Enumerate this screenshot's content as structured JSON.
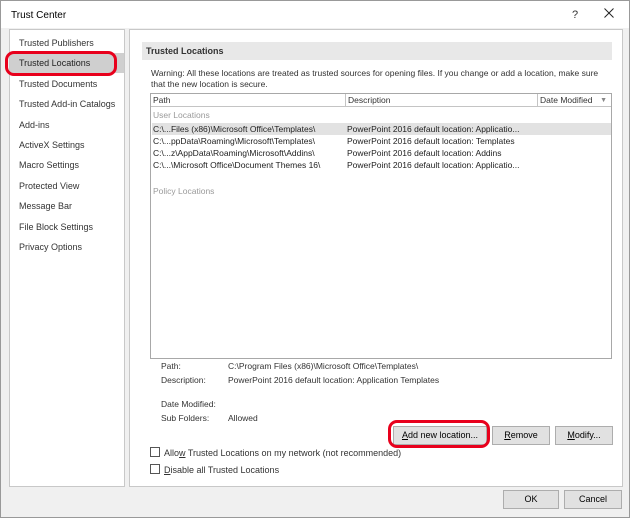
{
  "window": {
    "title": "Trust Center",
    "help_label": "?"
  },
  "sidebar": {
    "items": [
      {
        "label": "Trusted Publishers"
      },
      {
        "label": "Trusted Locations"
      },
      {
        "label": "Trusted Documents"
      },
      {
        "label": "Trusted Add-in Catalogs"
      },
      {
        "label": "Add-ins"
      },
      {
        "label": "ActiveX Settings"
      },
      {
        "label": "Macro Settings"
      },
      {
        "label": "Protected View"
      },
      {
        "label": "Message Bar"
      },
      {
        "label": "File Block Settings"
      },
      {
        "label": "Privacy Options"
      }
    ],
    "selected_index": 1
  },
  "main": {
    "section_title": "Trusted Locations",
    "warning": "Warning: All these locations are treated as trusted sources for opening files.  If you change or add a location, make sure that the new location is secure.",
    "columns": {
      "path": "Path",
      "description": "Description",
      "date_modified": "Date Modified"
    },
    "user_group_label": "User Locations",
    "policy_group_label": "Policy Locations",
    "rows": [
      {
        "path": "C:\\...Files (x86)\\Microsoft Office\\Templates\\",
        "description": "PowerPoint 2016 default location: Applicatio..."
      },
      {
        "path": "C:\\...ppData\\Roaming\\Microsoft\\Templates\\",
        "description": "PowerPoint 2016 default location: Templates"
      },
      {
        "path": "C:\\...z\\AppData\\Roaming\\Microsoft\\Addins\\",
        "description": "PowerPoint 2016 default location: Addins"
      },
      {
        "path": "C:\\...\\Microsoft Office\\Document Themes 16\\",
        "description": "PowerPoint 2016 default location: Applicatio..."
      }
    ],
    "details": {
      "path_label": "Path:",
      "path_value": "C:\\Program Files (x86)\\Microsoft Office\\Templates\\",
      "description_label": "Description:",
      "description_value": "PowerPoint 2016 default location: Application Templates",
      "date_modified_label": "Date Modified:",
      "sub_folders_label": "Sub Folders:",
      "sub_folders_value": "Allowed"
    },
    "buttons": {
      "add_hotkey": "A",
      "add_rest": "dd new location...",
      "remove_hotkey": "R",
      "remove_rest": "emove",
      "modify_hotkey": "M",
      "modify_rest": "odify..."
    },
    "checkboxes": {
      "allow_network_prefix": "Allo",
      "allow_network_hotkey": "w",
      "allow_network_rest": " Trusted Locations on my network (not recommended)",
      "disable_all_hotkey": "D",
      "disable_all_rest": "isable all Trusted Locations",
      "allow_network_checked": false,
      "disable_all_checked": false
    }
  },
  "footer": {
    "ok_label": "OK",
    "cancel_label": "Cancel"
  },
  "annotations": {
    "highlight_color": "#e8001c"
  }
}
